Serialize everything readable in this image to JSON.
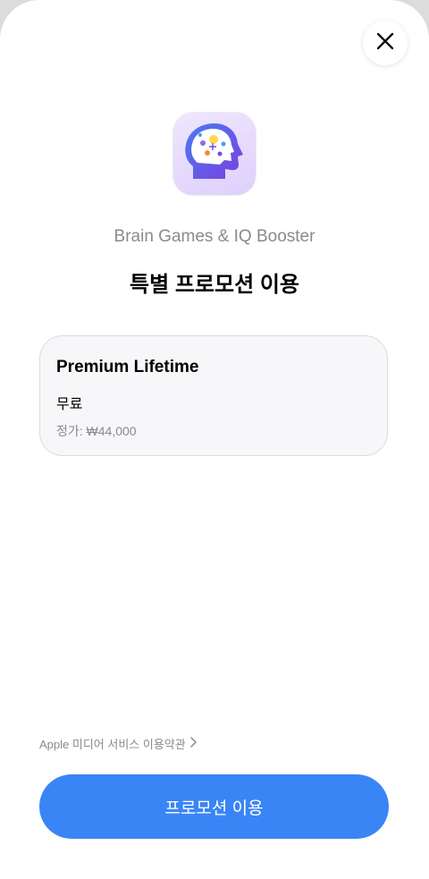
{
  "app": {
    "name": "Brain Games & IQ Booster",
    "icon": "brain-head-icon"
  },
  "header": {
    "title": "특별 프로모션 이용",
    "close_icon": "close-icon"
  },
  "plan": {
    "name": "Premium Lifetime",
    "price": "무료",
    "regular_price": "정가: ₩44,000"
  },
  "footer": {
    "terms_label": "Apple 미디어 서비스 이용약관",
    "terms_icon": "chevron-right-icon",
    "cta_label": "프로모션 이용"
  },
  "colors": {
    "accent": "#3a85f5",
    "icon_bg": "#e6dcfd",
    "icon_head": "#6b4ee8"
  }
}
